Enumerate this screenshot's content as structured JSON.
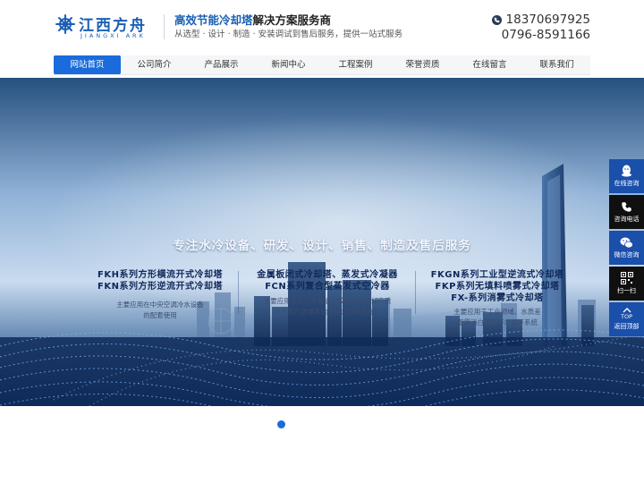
{
  "header": {
    "logo_cn": "江西方舟",
    "logo_en": "JIANGXI ARK",
    "slogan_highlight": "高效节能冷却塔",
    "slogan_rest": "解决方案服务商",
    "slogan_sub": "从选型 · 设计 · 制造 · 安装调试到售后服务，提供一站式服务",
    "mobile": "18370697925",
    "tel": "0796-8591166"
  },
  "nav": {
    "items": [
      {
        "label": "网站首页",
        "active": true
      },
      {
        "label": "公司简介",
        "active": false
      },
      {
        "label": "产品展示",
        "active": false
      },
      {
        "label": "新闻中心",
        "active": false
      },
      {
        "label": "工程案例",
        "active": false
      },
      {
        "label": "荣誉资质",
        "active": false
      },
      {
        "label": "在线留言",
        "active": false
      },
      {
        "label": "联系我们",
        "active": false
      }
    ]
  },
  "banner": {
    "headline": "专注水冷设备、研发、设计、销售、制造及售后服务",
    "columns": [
      {
        "lines": [
          "FKH系列方形横流开式冷却塔",
          "FKN系列方形逆流开式冷却塔"
        ],
        "notes": [
          "主要应用在中央空调冷水设备",
          "的配套使用"
        ]
      },
      {
        "lines": [
          "金属板闭式冷却塔、蒸发式冷凝器",
          "FCN系列复合型蒸发式空冷器"
        ],
        "notes": [
          "主要应用于对水质要求比较高以及冷却介质",
          "为气态介质或其他液态介质等领域。"
        ]
      },
      {
        "lines": [
          "FKGN系列工业型逆流式冷却塔",
          "FKP系列无填料喷雾式冷却塔",
          "FX-系列消雾式冷却塔"
        ],
        "notes": [
          "主要应用于工业领域、水质差",
          "烟雾消白等循环水循环系统"
        ]
      }
    ]
  },
  "sidebar": {
    "items": [
      {
        "label": "在线咨询",
        "icon": "qq-icon"
      },
      {
        "label": "咨询电话",
        "icon": "phone-icon"
      },
      {
        "label": "微信咨询",
        "icon": "wechat-icon"
      },
      {
        "label": "扫一扫",
        "icon": "qrcode-icon"
      },
      {
        "top_text": "TOP",
        "label": "返回顶部",
        "icon": "arrow-up-icon"
      }
    ]
  },
  "carousel": {
    "active_index": 0,
    "count": 1
  },
  "colors": {
    "brand_blue": "#1a6bdc",
    "logo_blue": "#1a5fb4",
    "sidebar_blue": "#1a4faa",
    "sidebar_dark": "#101010"
  }
}
